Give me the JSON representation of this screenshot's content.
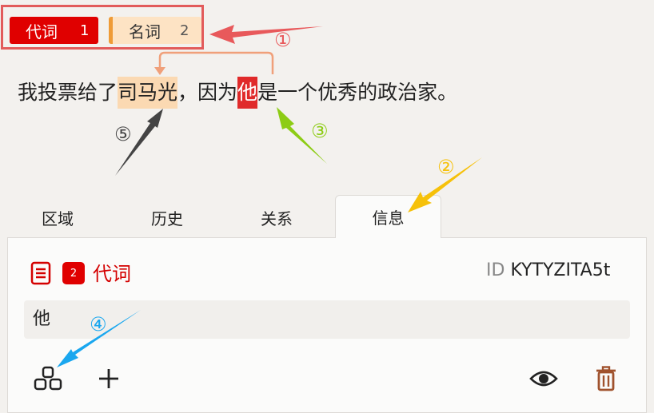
{
  "labels": [
    {
      "name": "代词",
      "count": "1"
    },
    {
      "name": "名词",
      "count": "2"
    }
  ],
  "sentence": {
    "before": "我投票给了",
    "noun": "司马光",
    "middle": "，因为",
    "pronoun": "他",
    "after": "是一个优秀的政治家。"
  },
  "tabs": [
    "区域",
    "历史",
    "关系",
    "信息"
  ],
  "active_tab": "信息",
  "panel": {
    "badge": "2",
    "label_name": "代词",
    "id_prefix": "ID",
    "id_value": "KYTYZITA5t",
    "text": "他"
  },
  "annotations": {
    "n1": "①",
    "n2": "②",
    "n3": "③",
    "n4": "④",
    "n5": "⑤"
  },
  "colors": {
    "pronoun": "#e00000",
    "noun_bg": "#fde3c4",
    "noun_bar": "#ef9b36",
    "arrow_red": "#e8595b",
    "arrow_orange": "#f6c10a",
    "arrow_green": "#8dcc15",
    "arrow_blue": "#1aa7ef",
    "arrow_gray": "#444444",
    "arrow_link": "#f0a07a",
    "trash": "#a0522d"
  },
  "icons": [
    "document-icon",
    "relation-icon",
    "plus-icon",
    "eye-icon",
    "trash-icon"
  ]
}
